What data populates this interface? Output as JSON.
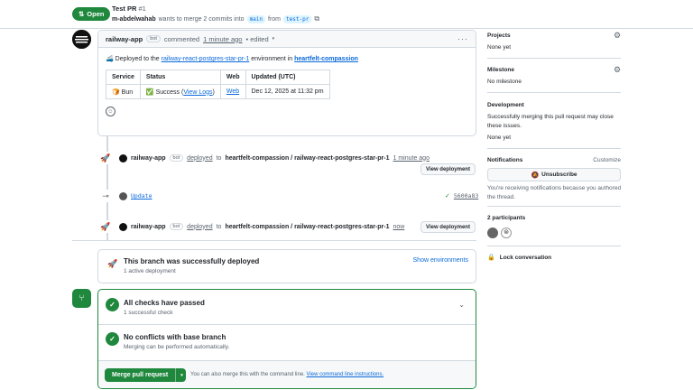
{
  "header": {
    "title": "Test PR",
    "number": "#1",
    "status": "Open",
    "author": "m-abdelwahab",
    "merge_text": "wants to merge 2 commits into",
    "base_branch": "main",
    "from_text": "from",
    "head_branch": "test-pr"
  },
  "comment": {
    "author": "railway-app",
    "bot_badge": "bot",
    "commented": "commented",
    "time": "1 minute ago",
    "edited": "• edited",
    "body_prefix": "🚄 Deployed to the",
    "body_link": "railway-react-postgres-star-pr-1",
    "body_middle": "environment in",
    "body_project": "heartfelt-compassion",
    "table": {
      "headers": [
        "Service",
        "Status",
        "Web",
        "Updated (UTC)"
      ],
      "row": {
        "service": "🍞 Bun",
        "status_prefix": "✅ Success (",
        "status_link": "View Logs",
        "status_suffix": ")",
        "web": "Web",
        "updated": "Dec 12, 2025 at 11:32 pm"
      }
    }
  },
  "timeline": [
    {
      "actor": "railway-app",
      "bot": "bot",
      "verb": "deployed",
      "to": "to",
      "target": "heartfelt-compassion / railway-react-postgres-star-pr-1",
      "time": "1 minute ago",
      "button": "View deployment"
    },
    {
      "commit_message": "Update",
      "commit_sha": "5600a83"
    },
    {
      "actor": "railway-app",
      "bot": "bot",
      "verb": "deployed",
      "to": "to",
      "target": "heartfelt-compassion / railway-react-postgres-star-pr-1",
      "time": "now",
      "button": "View deployment"
    }
  ],
  "deployed_box": {
    "title": "This branch was successfully deployed",
    "subtitle": "1 active deployment",
    "link": "Show environments"
  },
  "merge_box": {
    "checks_title": "All checks have passed",
    "checks_subtitle": "1 successful check",
    "conflicts_title": "No conflicts with base branch",
    "conflicts_subtitle": "Merging can be performed automatically.",
    "merge_button": "Merge pull request",
    "cli_text": "You can also merge this with the command line.",
    "cli_link": "View command line instructions."
  },
  "sidebar": {
    "projects_title": "Projects",
    "projects_value": "None yet",
    "milestone_title": "Milestone",
    "milestone_value": "No milestone",
    "development_title": "Development",
    "development_text": "Successfully merging this pull request may close these issues.",
    "development_value": "None yet",
    "notifications_title": "Notifications",
    "customize": "Customize",
    "unsubscribe": "Unsubscribe",
    "notifications_reason": "You're receiving notifications because you authored the thread.",
    "participants_title": "2 participants",
    "lock": "Lock conversation"
  },
  "colors": {
    "accent": "#0969da",
    "success": "#1f883d",
    "border": "#d1d9e0"
  }
}
